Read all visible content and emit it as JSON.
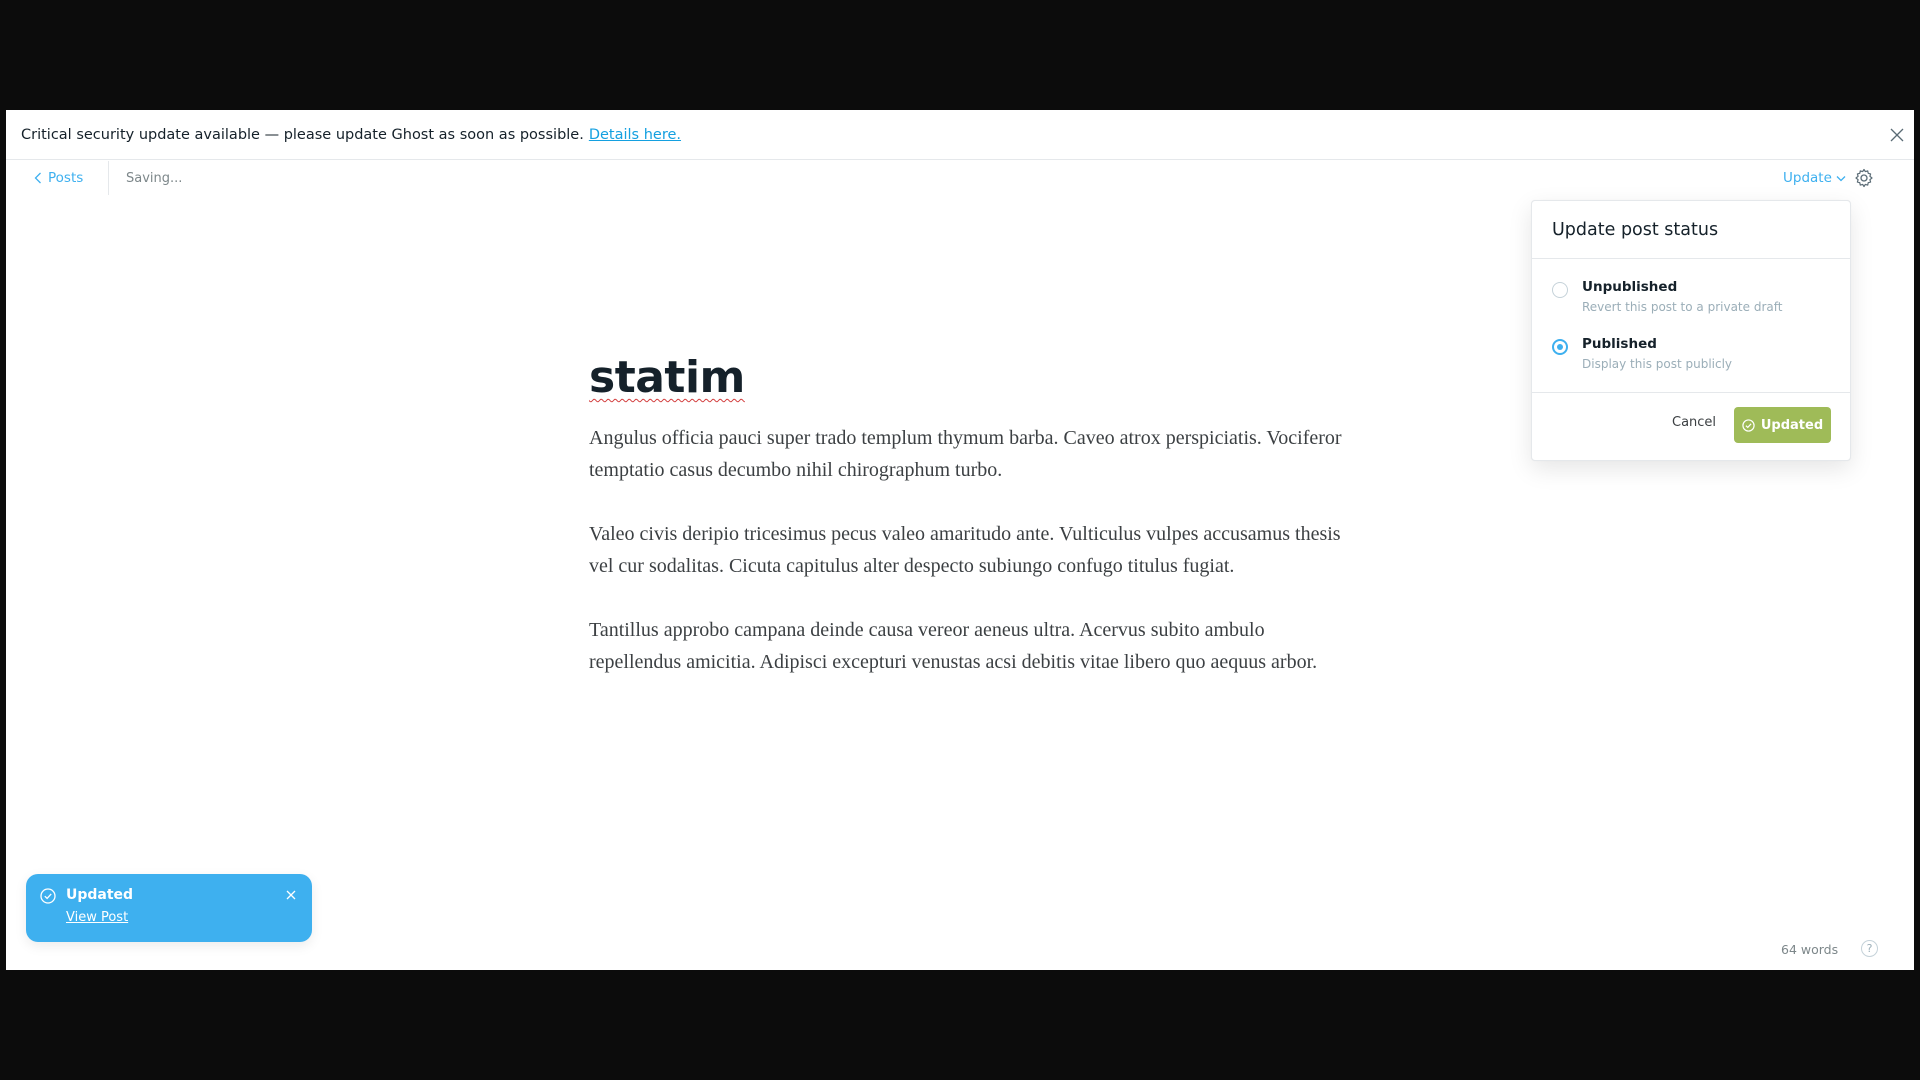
{
  "banner": {
    "message": "Critical security update available — please update Ghost as soon as possible.",
    "link_label": "Details here."
  },
  "header": {
    "back_label": "Posts",
    "status": "Saving...",
    "update_label": "Update"
  },
  "post": {
    "title": "statim",
    "paragraphs": [
      "Angulus officia pauci super trado templum thymum barba. Caveo atrox perspiciatis. Vociferor temptatio casus decumbo nihil chirographum turbo.",
      "Valeo civis deripio tricesimus pecus valeo amaritudo ante. Vulticulus vulpes accusamus thesis vel cur sodalitas. Cicuta capitulus alter despecto subiungo confugo titulus fugiat.",
      "Tantillus approbo campana deinde causa vereor aeneus ultra. Acervus subito ambulo repellendus amicitia. Adipisci excepturi venustas acsi debitis vitae libero quo aequus arbor."
    ]
  },
  "popover": {
    "title": "Update post status",
    "options": [
      {
        "label": "Unpublished",
        "description": "Revert this post to a private draft",
        "selected": false
      },
      {
        "label": "Published",
        "description": "Display this post publicly",
        "selected": true
      }
    ],
    "cancel_label": "Cancel",
    "confirm_label": "Updated"
  },
  "toast": {
    "title": "Updated",
    "link_label": "View Post"
  },
  "footer": {
    "word_count": "64 words",
    "help_glyph": "?"
  },
  "colors": {
    "accent_blue": "#3eb0ef",
    "success_green": "#9fbb58",
    "text_dark": "#15212a"
  }
}
